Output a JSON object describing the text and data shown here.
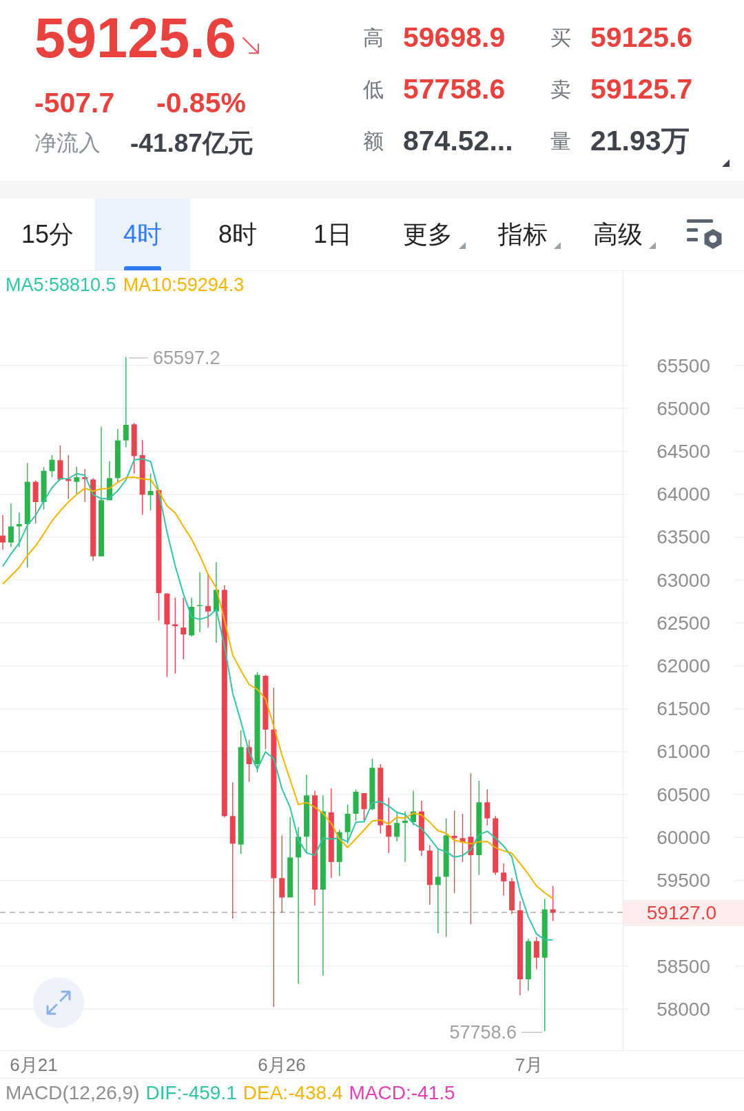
{
  "quote": {
    "price": "59125.6",
    "falling": true,
    "change": "-507.7",
    "change_percent": "-0.85%",
    "inflow_label": "净流入",
    "inflow_value": "-41.87亿元"
  },
  "stats": [
    {
      "label": "高",
      "value": "59698.9",
      "color": "#e8413e"
    },
    {
      "label": "买",
      "value": "59125.6",
      "color": "#e8413e"
    },
    {
      "label": "低",
      "value": "57758.6",
      "color": "#e8413e"
    },
    {
      "label": "卖",
      "value": "59125.7",
      "color": "#e8413e"
    },
    {
      "label": "额",
      "value": "874.52...",
      "color": "#3f444c"
    },
    {
      "label": "量",
      "value": "21.93万",
      "color": "#3f444c"
    }
  ],
  "tabs": [
    {
      "label": "15分",
      "selected": false,
      "dropdown": false
    },
    {
      "label": "4时",
      "selected": true,
      "dropdown": false
    },
    {
      "label": "8时",
      "selected": false,
      "dropdown": false
    },
    {
      "label": "1日",
      "selected": false,
      "dropdown": false
    },
    {
      "label": "更多",
      "selected": false,
      "dropdown": true
    },
    {
      "label": "指标",
      "selected": false,
      "dropdown": true
    },
    {
      "label": "高级",
      "selected": false,
      "dropdown": true
    }
  ],
  "chart": {
    "legend": [
      {
        "label": "MA5:58810.5",
        "color": "#33c4a5"
      },
      {
        "label": "MA10:59294.3",
        "color": "#f5b400"
      }
    ],
    "y_axis": [
      "65500",
      "65000",
      "64500",
      "64000",
      "63500",
      "63000",
      "62500",
      "62000",
      "61500",
      "61000",
      "60500",
      "60000",
      "59500",
      "58500",
      "58000"
    ],
    "high_label": "65597.2",
    "low_label": "57758.6",
    "last_price": "59127.0",
    "x_axis": [
      "6月21",
      "6月26",
      "7月"
    ]
  },
  "macd": {
    "label": "MACD(12,26,9)",
    "values": [
      {
        "label": "DIF:-459.1",
        "color": "#2fc4a2"
      },
      {
        "label": "DEA:-438.4",
        "color": "#f5b400"
      },
      {
        "label": "MACD:-41.5",
        "color": "#e040b4"
      }
    ]
  }
}
